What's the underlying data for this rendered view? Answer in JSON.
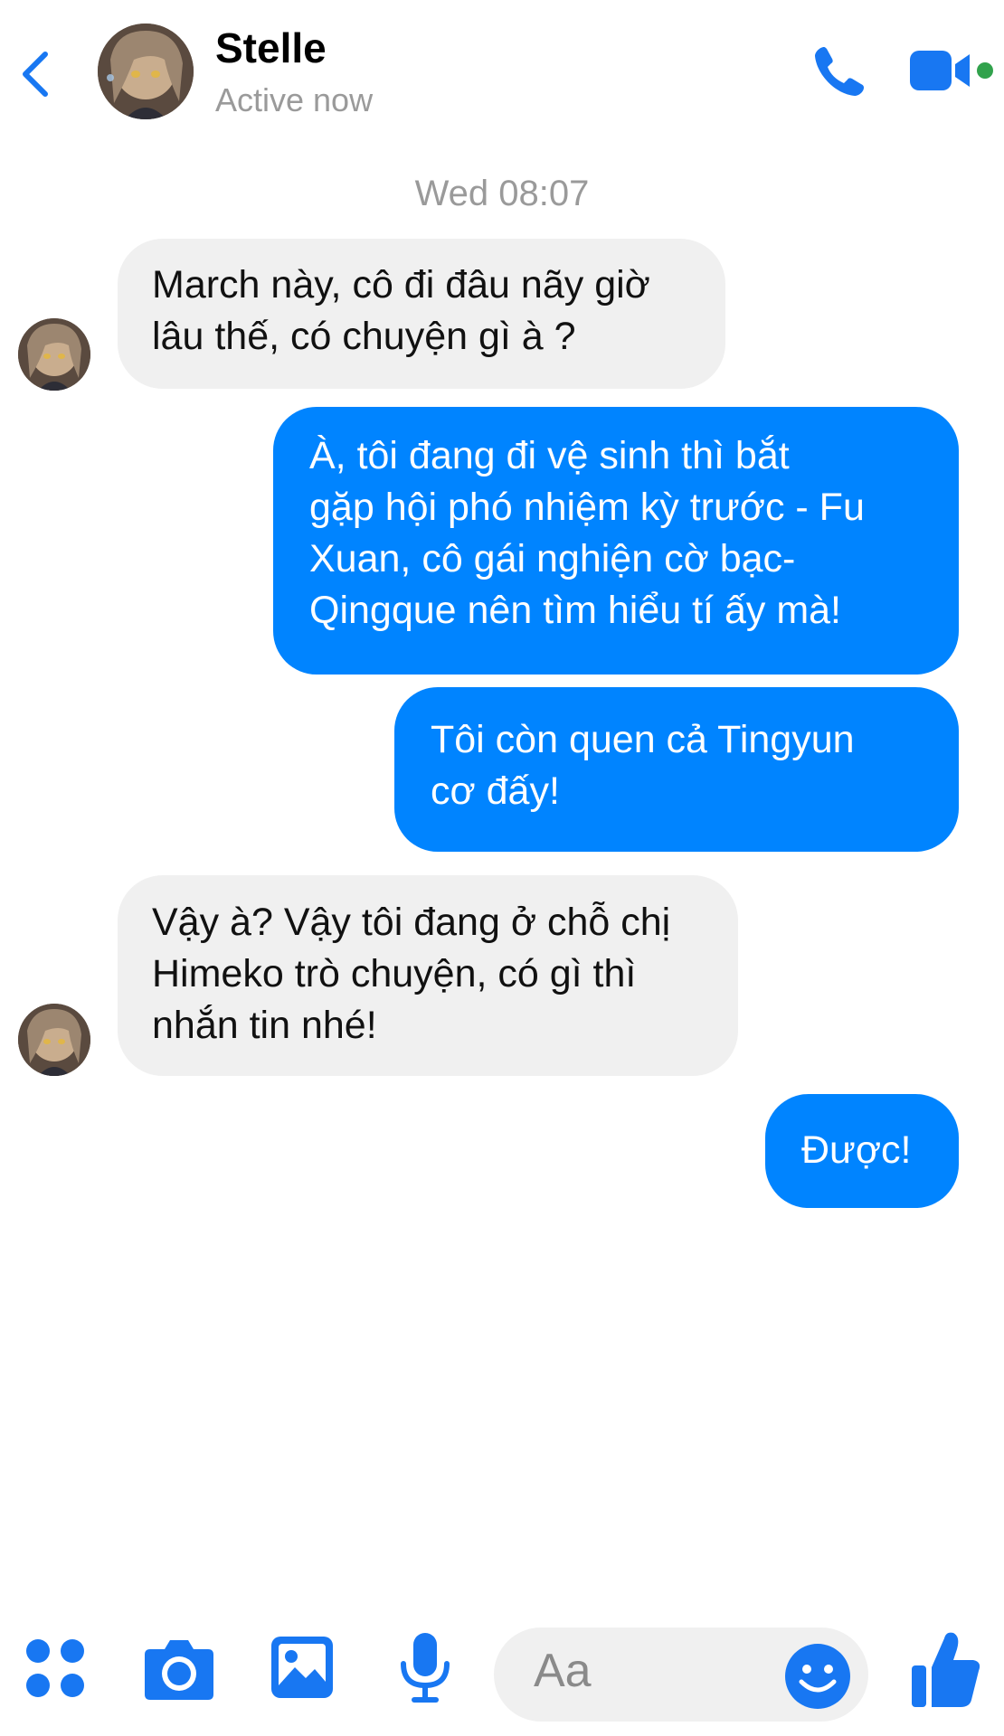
{
  "header": {
    "contact_name": "Stelle",
    "status": "Active now"
  },
  "conversation": {
    "timestamp": "Wed 08:07",
    "messages": [
      {
        "sender": "contact",
        "lines": [
          "March này, cô đi đâu nãy giờ",
          "lâu thế, có chuyện gì à ?"
        ]
      },
      {
        "sender": "me",
        "lines": [
          "À, tôi đang đi vệ sinh thì bắt",
          "gặp hội phó nhiệm kỳ trước - Fu",
          "Xuan, cô gái nghiện cờ bạc-",
          "Qingque nên tìm hiểu tí ấy mà!"
        ]
      },
      {
        "sender": "me",
        "lines": [
          "Tôi còn quen cả Tingyun",
          "cơ đấy!"
        ]
      },
      {
        "sender": "contact",
        "lines": [
          "Vậy à? Vậy tôi đang ở chỗ chị",
          "Himeko trò chuyện, có gì thì",
          "nhắn tin nhé!"
        ]
      },
      {
        "sender": "me",
        "lines": [
          "Được!"
        ]
      }
    ]
  },
  "composer": {
    "placeholder": "Aa",
    "icons": [
      "apps-icon",
      "camera-icon",
      "gallery-icon",
      "microphone-icon",
      "emoji-icon",
      "thumbs-up-icon"
    ]
  },
  "colors": {
    "accent": "#0084ff",
    "icon_blue": "#1877f2",
    "incoming_bubble": "#f0f0f0",
    "online": "#31a24c",
    "muted_text": "#9a9a9a"
  }
}
